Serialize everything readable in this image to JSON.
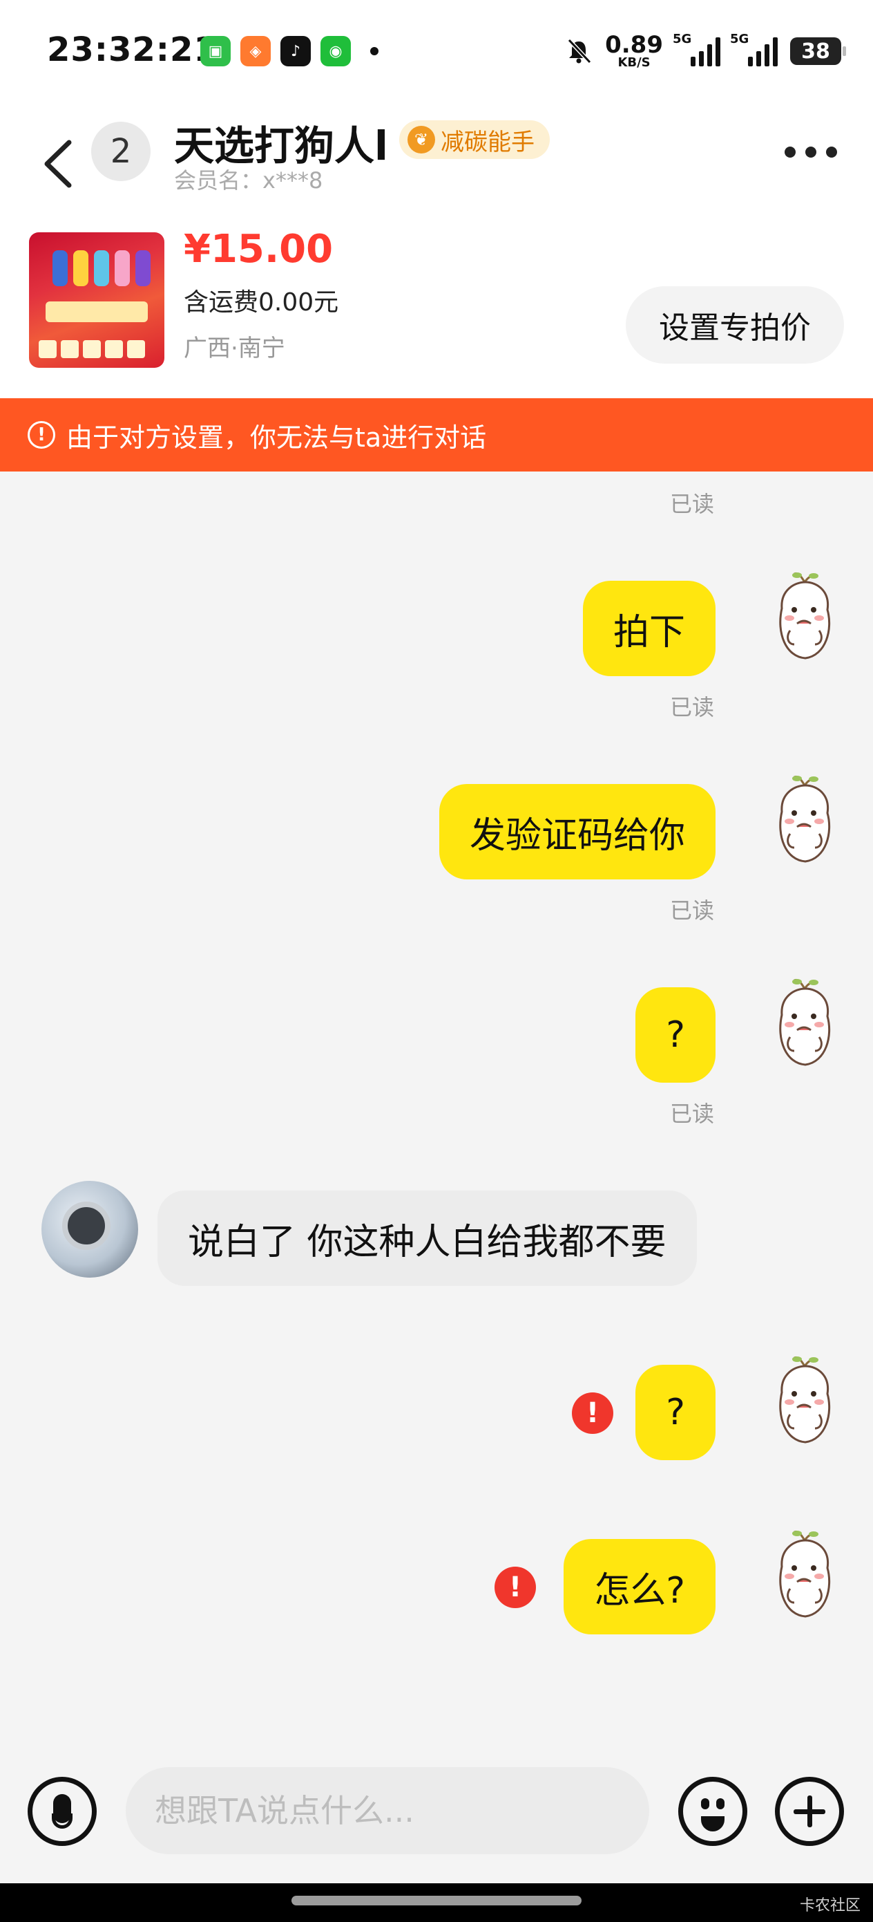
{
  "status_bar": {
    "time": "23:32:21",
    "net_speed": "0.89",
    "net_unit": "KB/S",
    "signal_1": "5G",
    "signal_2": "5G",
    "battery": "38"
  },
  "header": {
    "unread_count": "2",
    "title": "天选打狗人l",
    "badge": "减碳能手",
    "member": "会员名：x***8"
  },
  "product": {
    "price": "¥15.00",
    "shipping": "含运费0.00元",
    "location": "广西·南宁",
    "action_label": "设置专拍价"
  },
  "warning": {
    "text": "由于对方设置，你无法与ta进行对话"
  },
  "messages": [
    {
      "text": "拍下",
      "status": "已读"
    },
    {
      "text": "发验证码给你",
      "status": "已读"
    },
    {
      "text": "?",
      "status": "已读"
    },
    {
      "text": "说白了 你这种人白给我都不要"
    },
    {
      "text": "?",
      "failed": true
    },
    {
      "text": "怎么?",
      "failed": true
    }
  ],
  "top_read": "已读",
  "input": {
    "placeholder": "想跟TA说点什么..."
  },
  "watermark": "卡农社区",
  "colors": {
    "accent": "#ff5722",
    "bubble_mine": "#ffe60f",
    "price": "#ff3b30",
    "fail": "#f0362c"
  }
}
